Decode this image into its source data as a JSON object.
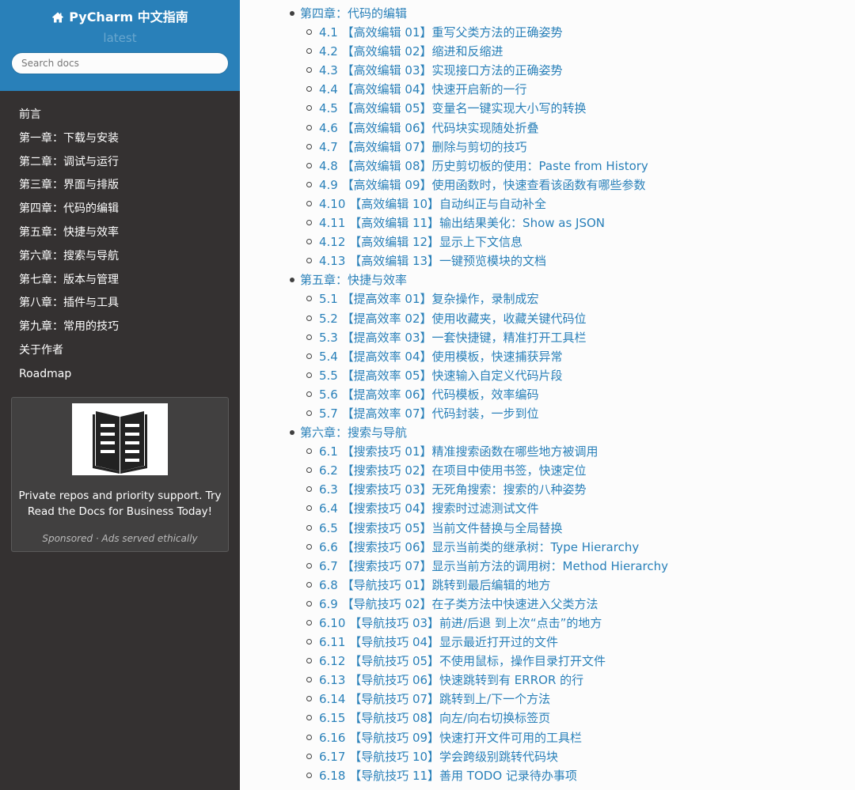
{
  "brand": {
    "title": "PyCharm 中文指南",
    "version": "latest",
    "icon": "home-icon"
  },
  "search": {
    "placeholder": "Search docs",
    "value": ""
  },
  "sidebar": {
    "items": [
      {
        "label": "前言"
      },
      {
        "label": "第一章：下载与安装"
      },
      {
        "label": "第二章：调试与运行"
      },
      {
        "label": "第三章：界面与排版"
      },
      {
        "label": "第四章：代码的编辑"
      },
      {
        "label": "第五章：快捷与效率"
      },
      {
        "label": "第六章：搜索与导航"
      },
      {
        "label": "第七章：版本与管理"
      },
      {
        "label": "第八章：插件与工具"
      },
      {
        "label": "第九章：常用的技巧"
      },
      {
        "label": "关于作者"
      },
      {
        "label": "Roadmap"
      }
    ]
  },
  "ad": {
    "icon": "book-icon",
    "text": "Private repos and priority support. Try Read the Docs for Business Today!",
    "sponsor": "Sponsored · Ads served ethically"
  },
  "toc": {
    "chapters": [
      {
        "title": "第四章：代码的编辑",
        "sections": [
          {
            "num": "4.1",
            "title": "【高效编辑 01】重写父类方法的正确姿势"
          },
          {
            "num": "4.2",
            "title": "【高效编辑 02】缩进和反缩进"
          },
          {
            "num": "4.3",
            "title": "【高效编辑 03】实现接口方法的正确姿势"
          },
          {
            "num": "4.4",
            "title": "【高效编辑 04】快速开启新的一行"
          },
          {
            "num": "4.5",
            "title": "【高效编辑 05】变量名一键实现大小写的转换"
          },
          {
            "num": "4.6",
            "title": "【高效编辑 06】代码块实现随处折叠"
          },
          {
            "num": "4.7",
            "title": "【高效编辑 07】删除与剪切的技巧"
          },
          {
            "num": "4.8",
            "title": "【高效编辑 08】历史剪切板的使用：Paste from History"
          },
          {
            "num": "4.9",
            "title": "【高效编辑 09】使用函数时，快速查看该函数有哪些参数"
          },
          {
            "num": "4.10",
            "title": "【高效编辑 10】自动纠正与自动补全"
          },
          {
            "num": "4.11",
            "title": "【高效编辑 11】输出结果美化：Show as JSON"
          },
          {
            "num": "4.12",
            "title": "【高效编辑 12】显示上下文信息"
          },
          {
            "num": "4.13",
            "title": "【高效编辑 13】一键预览模块的文档"
          }
        ]
      },
      {
        "title": "第五章：快捷与效率",
        "sections": [
          {
            "num": "5.1",
            "title": "【提高效率 01】复杂操作，录制成宏"
          },
          {
            "num": "5.2",
            "title": "【提高效率 02】使用收藏夹，收藏关键代码位"
          },
          {
            "num": "5.3",
            "title": "【提高效率 03】一套快捷键，精准打开工具栏"
          },
          {
            "num": "5.4",
            "title": "【提高效率 04】使用模板，快速捕获异常"
          },
          {
            "num": "5.5",
            "title": "【提高效率 05】快速输入自定义代码片段"
          },
          {
            "num": "5.6",
            "title": "【提高效率 06】代码模板，效率编码"
          },
          {
            "num": "5.7",
            "title": "【提高效率 07】代码封装，一步到位"
          }
        ]
      },
      {
        "title": "第六章：搜索与导航",
        "sections": [
          {
            "num": "6.1",
            "title": "【搜索技巧 01】精准搜索函数在哪些地方被调用"
          },
          {
            "num": "6.2",
            "title": "【搜索技巧 02】在项目中使用书签，快速定位"
          },
          {
            "num": "6.3",
            "title": "【搜索技巧 03】无死角搜索：搜索的八种姿势"
          },
          {
            "num": "6.4",
            "title": "【搜索技巧 04】搜索时过滤测试文件"
          },
          {
            "num": "6.5",
            "title": "【搜索技巧 05】当前文件替换与全局替换"
          },
          {
            "num": "6.6",
            "title": "【搜索技巧 06】显示当前类的继承树：Type Hierarchy"
          },
          {
            "num": "6.7",
            "title": "【搜索技巧 07】显示当前方法的调用树：Method Hierarchy"
          },
          {
            "num": "6.8",
            "title": "【导航技巧 01】跳转到最后编辑的地方"
          },
          {
            "num": "6.9",
            "title": "【导航技巧 02】在子类方法中快速进入父类方法"
          },
          {
            "num": "6.10",
            "title": "【导航技巧 03】前进/后退 到上次“点击”的地方"
          },
          {
            "num": "6.11",
            "title": "【导航技巧 04】显示最近打开过的文件"
          },
          {
            "num": "6.12",
            "title": "【导航技巧 05】不使用鼠标，操作目录打开文件"
          },
          {
            "num": "6.13",
            "title": "【导航技巧 06】快速跳转到有 ERROR 的行"
          },
          {
            "num": "6.14",
            "title": "【导航技巧 07】跳转到上/下一个方法"
          },
          {
            "num": "6.15",
            "title": "【导航技巧 08】向左/向右切换标签页"
          },
          {
            "num": "6.16",
            "title": "【导航技巧 09】快速打开文件可用的工具栏"
          },
          {
            "num": "6.17",
            "title": "【导航技巧 10】学会跨级别跳转代码块"
          },
          {
            "num": "6.18",
            "title": "【导航技巧 11】善用 TODO 记录待办事项"
          }
        ]
      }
    ]
  },
  "colors": {
    "sidebar_bg": "#343131",
    "brand_bg": "#2980b9",
    "link": "#2980b9",
    "nav_text": "#ffffff"
  }
}
